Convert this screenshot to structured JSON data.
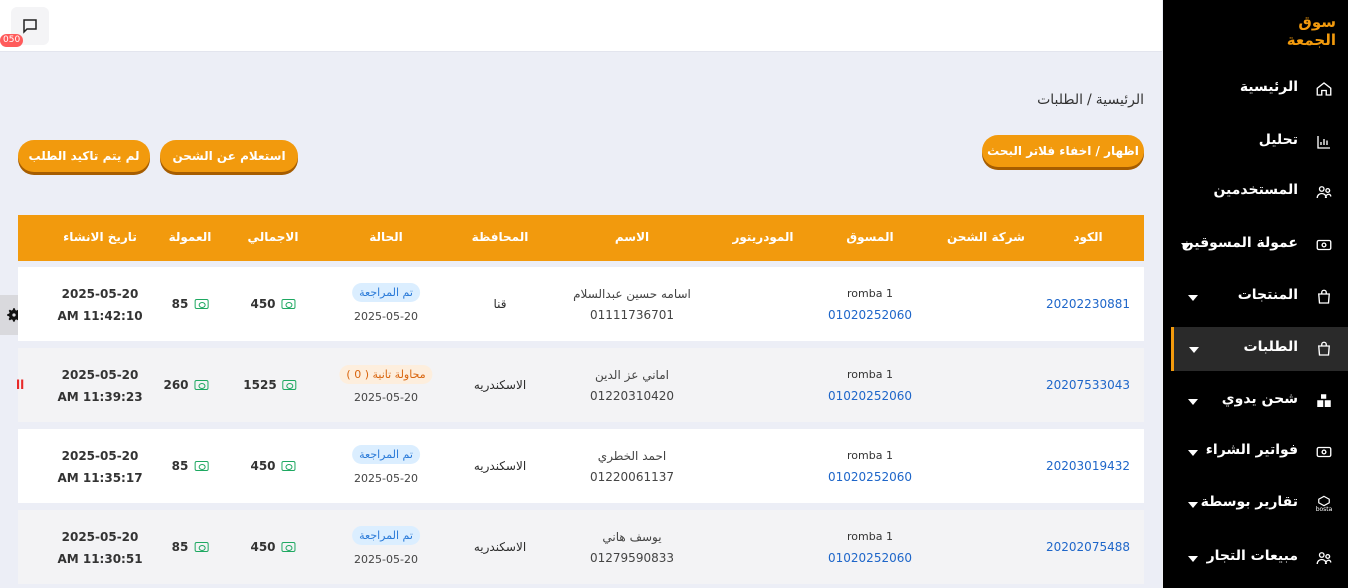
{
  "topbar": {
    "chat_badge": "050"
  },
  "sidebar": {
    "logo_text": "سوق الجمعة",
    "items": [
      {
        "label": "الرئيسية",
        "icon": "home-icon",
        "caret": false,
        "active": false
      },
      {
        "label": "تحليل",
        "icon": "chart-icon",
        "caret": false,
        "active": false
      },
      {
        "label": "المستخدمين",
        "icon": "users-icon",
        "caret": false,
        "active": false
      },
      {
        "label": "عمولة المسوقين",
        "icon": "cash-icon",
        "caret": true,
        "active": false
      },
      {
        "label": "المنتجات",
        "icon": "bag-icon",
        "caret": true,
        "active": false
      },
      {
        "label": "الطلبات",
        "icon": "bag-icon",
        "caret": true,
        "active": true
      },
      {
        "label": "شحن يدوي",
        "icon": "boxes-icon",
        "caret": true,
        "active": false
      },
      {
        "label": "فواتير الشراء",
        "icon": "cash-icon",
        "caret": true,
        "active": false
      },
      {
        "label": "تقارير بوسطة",
        "icon": "bosta-icon",
        "caret": true,
        "active": false
      },
      {
        "label": "مبيعات التجار",
        "icon": "users-icon",
        "caret": true,
        "active": false
      }
    ],
    "bosta_small": "bosta"
  },
  "breadcrumb": {
    "home": "الرئيسية",
    "sep": "/",
    "current": "الطلبات"
  },
  "buttons": {
    "toggle_filters": "اظهار / اخفاء فلاتر البحث",
    "shipping_inquiry": "استعلام عن الشحن",
    "unconfirmed": "لم يتم تاكيد الطلب"
  },
  "table": {
    "headers": {
      "code": "الكود",
      "shipping_company": "شركة الشحن",
      "marketer": "المسوق",
      "moderator": "المودريتور",
      "name": "الاسم",
      "governorate": "المحافظة",
      "status": "الحالة",
      "total": "الاجمالي",
      "commission": "العمولة",
      "created": "تاريخ الانشاء"
    },
    "rows": [
      {
        "code": "20202230881",
        "marketer_name": "romba 1",
        "marketer_phone": "01020252060",
        "cust_name": "اسامه حسين عبدالسلام",
        "cust_phone": "01111736701",
        "gov": "قنا",
        "status": "تم المراجعة",
        "status_type": "ok",
        "status_date": "2025-05-20",
        "total": "450",
        "commission": "85",
        "created_date": "2025-05-20",
        "created_time": "AM 11:42:10"
      },
      {
        "code": "20207533043",
        "marketer_name": "romba 1",
        "marketer_phone": "01020252060",
        "cust_name": "اماني عز الدين",
        "cust_phone": "01220310420",
        "gov": "الاسكندريه",
        "status": "محاولة تانية ( 0 )",
        "status_type": "warn",
        "status_date": "2025-05-20",
        "total": "1525",
        "commission": "260",
        "created_date": "2025-05-20",
        "created_time": "AM 11:39:23",
        "mark": "ll"
      },
      {
        "code": "20203019432",
        "marketer_name": "romba 1",
        "marketer_phone": "01020252060",
        "cust_name": "احمد الخطري",
        "cust_phone": "01220061137",
        "gov": "الاسكندريه",
        "status": "تم المراجعة",
        "status_type": "ok",
        "status_date": "2025-05-20",
        "total": "450",
        "commission": "85",
        "created_date": "2025-05-20",
        "created_time": "AM 11:35:17"
      },
      {
        "code": "20202075488",
        "marketer_name": "romba 1",
        "marketer_phone": "01020252060",
        "cust_name": "يوسف هاني",
        "cust_phone": "01279590833",
        "gov": "الاسكندريه",
        "status": "تم المراجعة",
        "status_type": "ok",
        "status_date": "2025-05-20",
        "total": "450",
        "commission": "85",
        "created_date": "2025-05-20",
        "created_time": "AM 11:30:51"
      }
    ]
  },
  "colors": {
    "accent": "#f29a0d",
    "link": "#1e66c9",
    "sidebar_bg": "#000000"
  }
}
